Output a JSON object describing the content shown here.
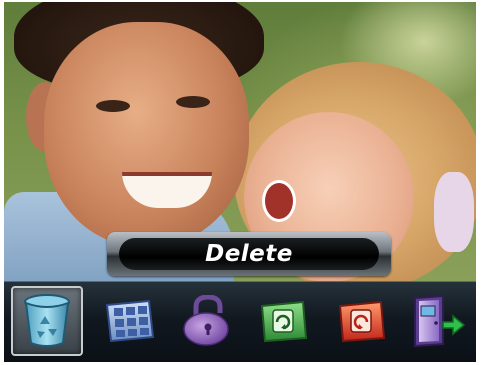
{
  "screen": {
    "mode_label": "Delete"
  },
  "toolbar": {
    "items": [
      {
        "icon": "trash-icon",
        "selected": true
      },
      {
        "icon": "grid-thumbnails-icon",
        "selected": false
      },
      {
        "icon": "lock-icon",
        "selected": false
      },
      {
        "icon": "rotate-photo-icon",
        "selected": false
      },
      {
        "icon": "rotate-photo-red-icon",
        "selected": false
      },
      {
        "icon": "exit-icon",
        "selected": false
      }
    ]
  },
  "colors": {
    "toolbar_bg": "#111820",
    "label_bg": "#000000",
    "label_text": "#ffffff",
    "selected_highlight": "#6a737b"
  }
}
